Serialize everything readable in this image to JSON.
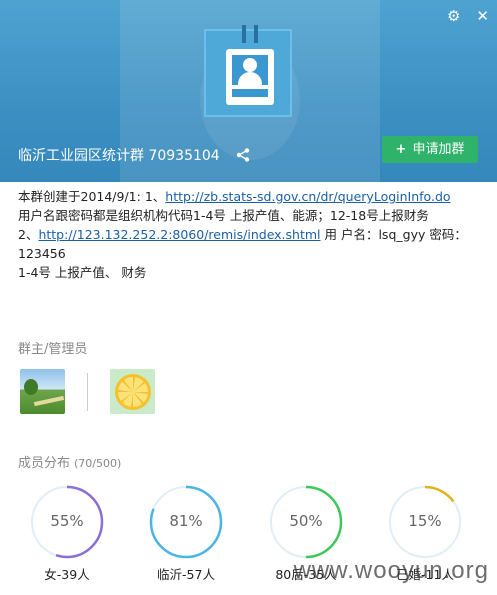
{
  "header": {
    "group_name": "临沂工业园区统计群 70935104",
    "join_button_label": "申请加群",
    "icons": [
      "settings-icon",
      "close-icon",
      "share-icon",
      "plus-icon"
    ]
  },
  "description": {
    "line1_prefix": "本群创建于2014/9/1:  1、",
    "link1": "http://zb.stats-sd.gov.cn/dr/queryLoginInfo.do",
    "line2": "用户名跟密码都是组织机构代码1-4号 上报产值、能源；12-18号上报财务",
    "line3_prefix": "2、",
    "link2": "http://123.132.252.2:8060/remis/index.shtml",
    "line3_suffix": " 用    户名：lsq_gyy 密码：",
    "line4": "123456",
    "line5": "1-4号 上报产值、 财务"
  },
  "admins": {
    "title": "群主/管理员"
  },
  "members": {
    "title": "成员分布",
    "count": "(70/500)",
    "stats": [
      {
        "percent_label": "55%",
        "value": 0.55,
        "label": "女-39人",
        "color": "#8a6fd6"
      },
      {
        "percent_label": "81%",
        "value": 0.81,
        "label": "临沂-57人",
        "color": "#4bb3e8"
      },
      {
        "percent_label": "50%",
        "value": 0.5,
        "label": "80后-35人",
        "color": "#3cc85a"
      },
      {
        "percent_label": "15%",
        "value": 0.15,
        "label": "已婚-11人",
        "color": "#e8b21a"
      }
    ]
  },
  "watermark": "www.wooyun.org"
}
